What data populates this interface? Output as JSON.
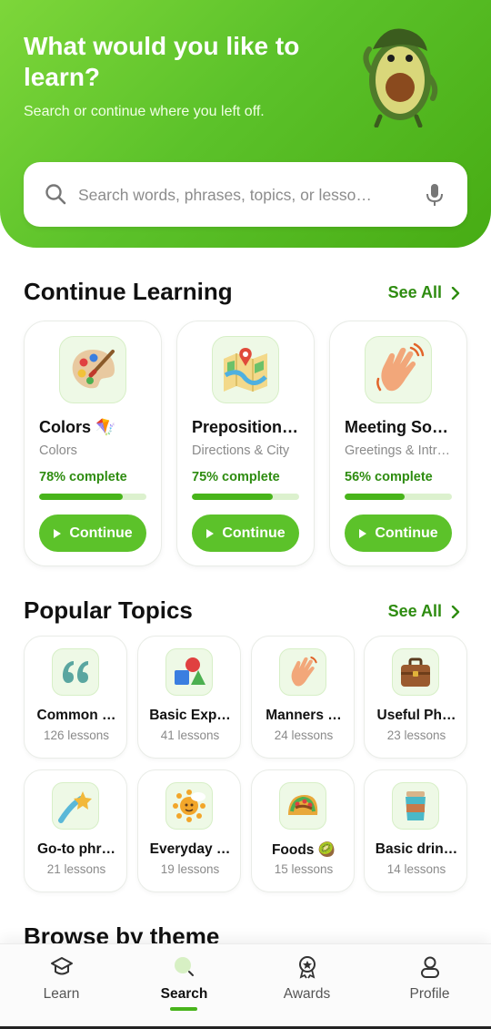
{
  "header": {
    "title": "What would you like to learn?",
    "subtitle": "Search or continue where you left off.",
    "mascot_icon": "avocado-mascot"
  },
  "search": {
    "placeholder": "Search words, phrases, topics, or lesso…",
    "value": "",
    "search_icon": "search-icon",
    "mic_icon": "microphone-icon"
  },
  "continue_learning": {
    "title": "Continue Learning",
    "see_all": "See All",
    "cards": [
      {
        "icon": "palette-icon",
        "title": "Colors 🪁",
        "subtitle": "Colors",
        "progress_text": "78% complete",
        "progress": 0.78,
        "button": "Continue"
      },
      {
        "icon": "map-icon",
        "title": "Preposition…",
        "subtitle": "Directions & City",
        "progress_text": "75% complete",
        "progress": 0.75,
        "button": "Continue"
      },
      {
        "icon": "waving-hand-icon",
        "title": "Meeting So…",
        "subtitle": "Greetings & Intr…",
        "progress_text": "56% complete",
        "progress": 0.56,
        "button": "Continue"
      }
    ]
  },
  "popular_topics": {
    "title": "Popular Topics",
    "see_all": "See All",
    "items": [
      {
        "icon": "quote-icon",
        "title": "Common …",
        "count": "126 lessons"
      },
      {
        "icon": "shapes-icon",
        "title": "Basic Exp…",
        "count": "41 lessons"
      },
      {
        "icon": "waving-hand-icon",
        "title": "Manners …",
        "count": "24 lessons"
      },
      {
        "icon": "briefcase-icon",
        "title": "Useful Ph…",
        "count": "23 lessons"
      },
      {
        "icon": "shooting-star-icon",
        "title": "Go-to phr…",
        "count": "21 lessons"
      },
      {
        "icon": "sun-icon",
        "title": "Everyday …",
        "count": "19 lessons"
      },
      {
        "icon": "taco-icon",
        "title": "Foods 🥝",
        "count": "15 lessons"
      },
      {
        "icon": "cup-icon",
        "title": "Basic drin…",
        "count": "14 lessons"
      }
    ]
  },
  "browse": {
    "title": "Browse by theme"
  },
  "nav": {
    "items": [
      {
        "label": "Learn",
        "icon": "graduation-cap-icon"
      },
      {
        "label": "Search",
        "icon": "search-icon"
      },
      {
        "label": "Awards",
        "icon": "award-icon"
      },
      {
        "label": "Profile",
        "icon": "user-icon"
      }
    ],
    "active": "Search"
  },
  "colors": {
    "brand": "#5cc22a",
    "brand_dark": "#2e8c10",
    "progress_track": "#dcf1ce"
  }
}
